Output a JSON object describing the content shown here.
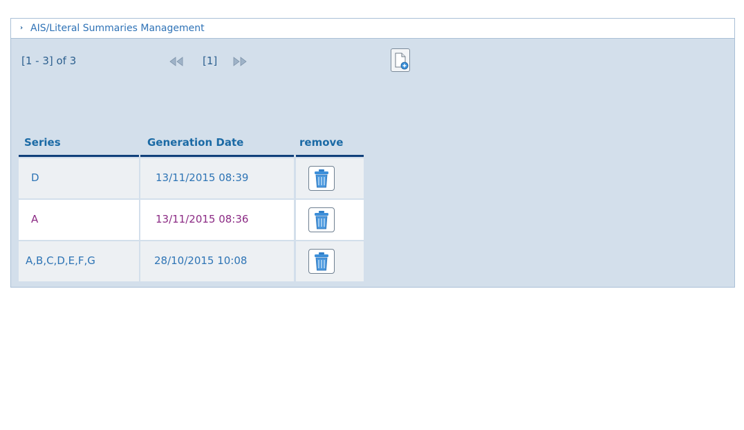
{
  "header": {
    "arrow": "›",
    "title": "AIS/Literal Summaries Management"
  },
  "pager": {
    "range": "[1 - 3] of 3",
    "current_page": "[1]",
    "prev_icon": "double-left-arrow-icon",
    "next_icon": "double-right-arrow-icon"
  },
  "toolbar": {
    "new_icon": "new-document-icon"
  },
  "table": {
    "columns": [
      "Series",
      "Generation Date",
      "remove"
    ],
    "rows": [
      {
        "series": "D",
        "date": "13/11/2015 08:39",
        "remove_icon": "trash-icon"
      },
      {
        "series": "A",
        "date": "13/11/2015 08:36",
        "remove_icon": "trash-icon"
      },
      {
        "series": "A,B,C,D,E,F,G",
        "date": "28/10/2015 10:08",
        "remove_icon": "trash-icon"
      }
    ]
  },
  "colors": {
    "panel_bg": "#d3dfeb",
    "header_text": "#1b6aa5",
    "header_underline": "#0f3f7a",
    "row_text_normal": "#2e74b5",
    "row_text_visited": "#8b2a84"
  }
}
